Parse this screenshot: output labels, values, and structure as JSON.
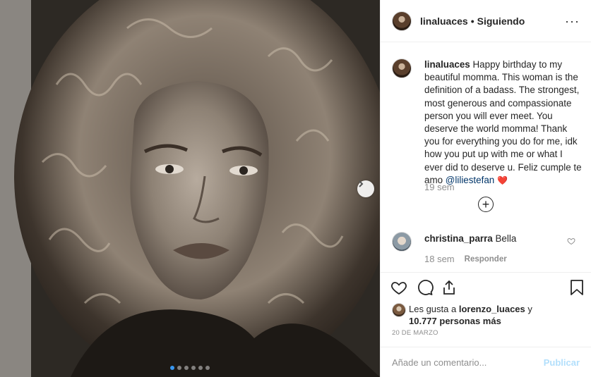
{
  "post": {
    "username": "linaluaces",
    "separator": "•",
    "follow_status": "Siguiendo",
    "more_icon": "more-horizontal-icon",
    "caption": {
      "username": "linaluaces",
      "text": "Happy birthday to my beautiful momma. This woman is the definition of a badass. The strongest, most generous and compassionate person you will ever meet. You deserve the world momma! Thank you for everything you do for me, idk how you put up with me or what I ever did to deserve u. Feliz cumple te amo",
      "mention": "@liliestefan",
      "emoji": "❤️",
      "time": "19 sem"
    },
    "load_more_icon": "plus-circle-icon",
    "comments": [
      {
        "username": "christina_parra",
        "text": "Bella",
        "time": "18 sem",
        "reply_label": "Responder"
      }
    ],
    "likes": {
      "prefix": "Les gusta a",
      "user": "lorenzo_luaces",
      "conjunction": "y",
      "count": "10.777 personas más"
    },
    "date": "20 DE MARZO",
    "comment_input": {
      "placeholder": "Añade un comentario...",
      "value": ""
    },
    "publish_label": "Publicar"
  },
  "carousel": {
    "slide_count": 6,
    "active_index": 0
  },
  "colors": {
    "accent": "#3897f0",
    "publish_disabled": "#b2dffc",
    "secondary_text": "#8e8e8e",
    "heart": "#e0245e"
  }
}
